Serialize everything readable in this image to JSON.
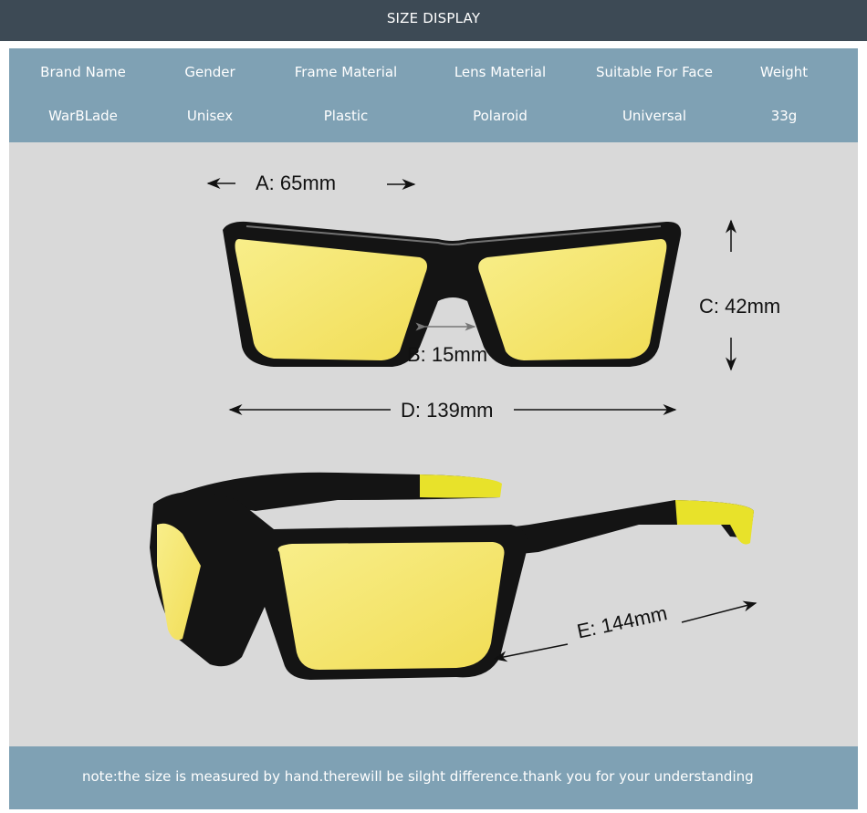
{
  "header": {
    "title": "SIZE DISPLAY"
  },
  "specs": [
    {
      "label": "Brand Name",
      "value": "WarBLade"
    },
    {
      "label": "Gender",
      "value": "Unisex"
    },
    {
      "label": "Frame Material",
      "value": "Plastic"
    },
    {
      "label": "Lens Material",
      "value": "Polaroid"
    },
    {
      "label": "Suitable For Face",
      "value": "Universal"
    },
    {
      "label": "Weight",
      "value": "33g"
    }
  ],
  "dimensions": {
    "a": "A: 65mm",
    "b": "B: 15mm",
    "c": "C: 42mm",
    "d": "D: 139mm",
    "e": "E: 144mm"
  },
  "colors": {
    "header_bg": "#3d4a55",
    "panel_bg": "#7fa1b4",
    "body_bg": "#d9d9d9",
    "lens_yellow": "#f4e66a",
    "frame_black": "#111111",
    "temple_yellow": "#e8e22a"
  },
  "note": {
    "text": "note:the size is measured by hand.therewill be silght difference.thank you for your understanding"
  }
}
